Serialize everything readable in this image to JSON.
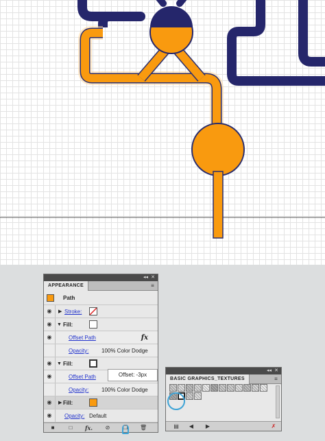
{
  "appearance": {
    "tab": "APPEARANCE",
    "header": "Path",
    "stroke_label": "Stroke:",
    "fill1_label": "Fill:",
    "offset1_label": "Offset Path",
    "opacity1_label": "Opacity:",
    "opacity1_value": "100% Color Dodge",
    "fill2_label": "Fill:",
    "offset2_label": "Offset Path",
    "opacity2_label": "Opacity:",
    "opacity2_value": "100% Color Dodge",
    "fill3_label": "Fill:",
    "opacity3_label": "Opacity:",
    "opacity3_value": "Default",
    "fx_glyph": "fx",
    "bottom_fx": "fx."
  },
  "tooltip": {
    "text": "Offset: -3px"
  },
  "swatch_library": {
    "tab": "BASIC GRAPHICS_TEXTURES"
  },
  "colors": {
    "navy": "#25266b",
    "orange": "#f99a0f",
    "glow": "#ffe0a8"
  }
}
